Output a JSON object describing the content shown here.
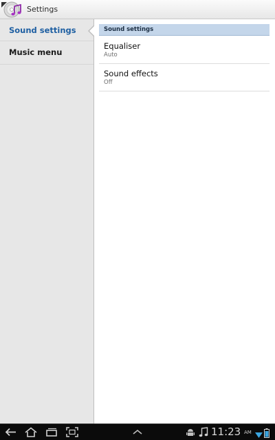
{
  "action_bar": {
    "title": "Settings",
    "app_icon": "music-app-icon"
  },
  "headers": [
    {
      "label": "Sound settings",
      "active": true
    },
    {
      "label": "Music menu",
      "active": false
    }
  ],
  "detail": {
    "section_title": "Sound settings",
    "items": [
      {
        "title": "Equaliser",
        "summary": "Auto"
      },
      {
        "title": "Sound effects",
        "summary": "Off"
      }
    ]
  },
  "system_bar": {
    "time": "11:23",
    "ampm": "AM",
    "nav_icons": [
      "back-icon",
      "home-icon",
      "recent-apps-icon",
      "screenshot-icon",
      "menu-up-icon"
    ],
    "status_icons": [
      "android-debug-icon",
      "music-note-icon",
      "wifi-icon",
      "battery-icon"
    ]
  },
  "colors": {
    "active_header": "#1e5fa2",
    "section_header_bg": "#c4d6ea",
    "system_bar_bg": "#0b0b0b"
  }
}
